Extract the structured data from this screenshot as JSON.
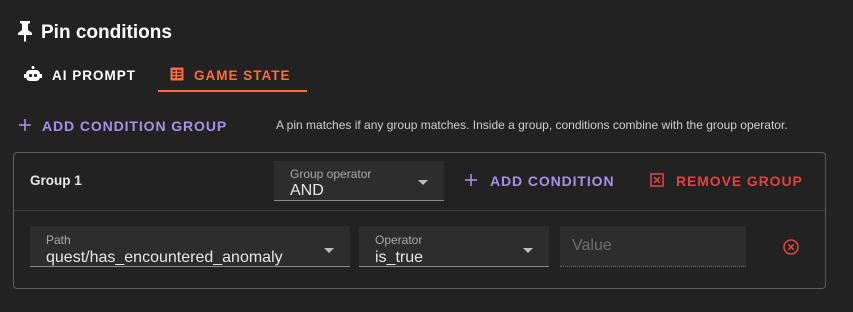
{
  "header": {
    "title": "Pin conditions",
    "icon": "pin-icon"
  },
  "tabs": [
    {
      "label": "AI PROMPT",
      "icon": "robot-icon",
      "active": false
    },
    {
      "label": "GAME STATE",
      "icon": "table-icon",
      "active": true
    }
  ],
  "toolbar": {
    "add_group_label": "ADD CONDITION GROUP",
    "help_text": "A pin matches if any group matches. Inside a group, conditions combine with the group operator."
  },
  "groups": [
    {
      "name": "Group 1",
      "operator": {
        "label": "Group operator",
        "value": "AND"
      },
      "add_condition_label": "ADD CONDITION",
      "remove_group_label": "REMOVE GROUP",
      "conditions": [
        {
          "path": {
            "label": "Path",
            "value": "quest/has_encountered_anomaly"
          },
          "operator": {
            "label": "Operator",
            "value": "is_true"
          },
          "value": {
            "placeholder": "Value",
            "value": ""
          }
        }
      ]
    }
  ],
  "colors": {
    "accent_orange": "#ff6d38",
    "accent_purple": "#a691e6",
    "danger_red": "#e0443e",
    "background": "#222222"
  }
}
